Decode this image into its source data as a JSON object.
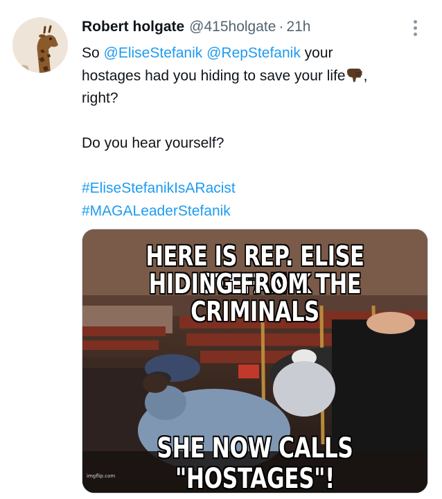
{
  "tweet": {
    "display_name": "Robert holgate",
    "handle": "@415holgate",
    "separator": "·",
    "time": "21h",
    "avatar_icon": "giraffe-avatar-icon",
    "more_icon": "more-options-icon",
    "text": {
      "line1_prefix": "So ",
      "mention1": "@EliseStefanik",
      "mention2": "@RepStefanik",
      "line1_suffix": " your",
      "line2_prefix": "hostages had you hiding to save your life",
      "line2_emoji": "backhand-index-pointing-down-emoji",
      "line2_suffix": ",",
      "line3": "right?",
      "line4": "Do you hear yourself?",
      "hashtag1": "#EliseStefanikIsARacist",
      "hashtag2": "#MAGALeaderStefanik"
    },
    "media": {
      "caption_top_1": "HERE IS REP. ELISE STEFANIK",
      "caption_top_2": "HIDING FROM THE CRIMINALS",
      "caption_bottom": "SHE NOW CALLS \"HOSTAGES\"!",
      "watermark": "imgflip.com"
    }
  },
  "colors": {
    "link": "#1d9bf0",
    "text": "#0f1419",
    "secondary": "#536471",
    "background": "#ffffff"
  }
}
